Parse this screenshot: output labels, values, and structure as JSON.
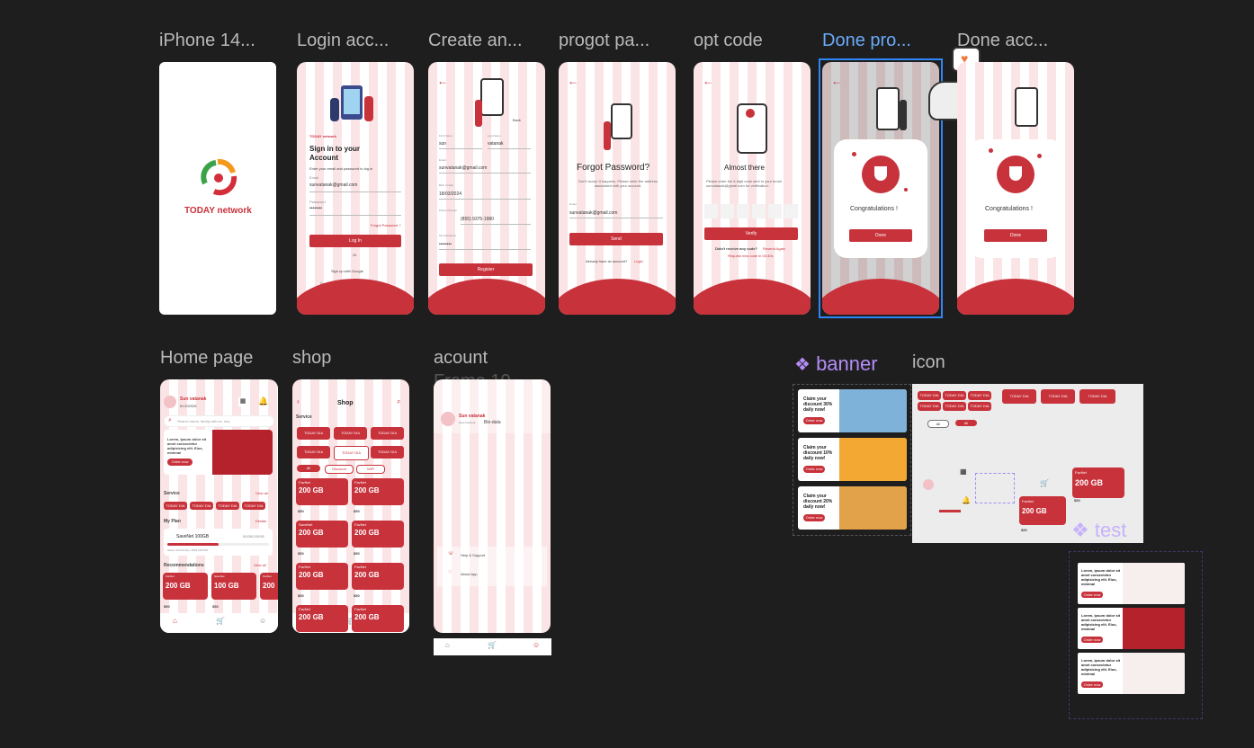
{
  "frames_row1": [
    {
      "label": "iPhone 14..."
    },
    {
      "label": "Login acc..."
    },
    {
      "label": "Create an..."
    },
    {
      "label": "progot pa..."
    },
    {
      "label": "opt code"
    },
    {
      "label": "Done pro..."
    },
    {
      "label": "Done acc..."
    }
  ],
  "frames_row2": [
    {
      "label": "Home page"
    },
    {
      "label": "shop"
    },
    {
      "label": "acount"
    },
    {
      "label": "Frame 10..."
    }
  ],
  "components": {
    "banner": "banner",
    "icon": "icon",
    "test": "test"
  },
  "splash": {
    "brand": "TODAY network"
  },
  "login": {
    "brand": "TODAY network",
    "title_line1": "Sign in to your",
    "title_line2": "Account",
    "subtitle": "Enter your email and password to log in",
    "email_label": "Email",
    "email_value": "sunvatanak@gmail.com",
    "password_label": "Password",
    "password_value": "••••••••",
    "forgot": "Forgot Password ?",
    "login_btn": "Log In",
    "or": "Or",
    "google": "Sign up with Google",
    "no_account": "Don't have an account?",
    "signup": "Sign Up"
  },
  "create": {
    "back": "Back",
    "first_name_label": "First Name",
    "first_name": "sun",
    "last_name_label": "Last Name",
    "last_name": "vatanak",
    "email_label": "Email",
    "email": "sunvatanak@gmail.com",
    "dob_label": "Birth of date",
    "dob": "18/03/2024",
    "phone_label": "Phone Number",
    "phone": "(855) 9375-1980",
    "password_label": "Set Password",
    "password": "••••••••",
    "register": "Register",
    "have_account": "Already have an account?",
    "login": "Login"
  },
  "forgot": {
    "title": "Forgot Password?",
    "desc": "Don't worry! It happens. Please enter the address associated with your account.",
    "email_label": "Email",
    "email": "sunvatanak@gmail.com",
    "send": "Send",
    "have_account": "Already have an account?",
    "login": "Login"
  },
  "otp": {
    "title": "Almost there",
    "desc": "Please enter the 6-digit code sent to your email sunvatanak@gmail.com for verification.",
    "verify": "Verify",
    "didnt_receive": "Didn't receive any code?",
    "resend": "Resend Again",
    "request": "Request new code in 00:30s"
  },
  "done": {
    "title": "Congratulations !",
    "button": "Done"
  },
  "home": {
    "name": "Sun vatanak",
    "id": "ID:202026",
    "search": "Search name, family with ex. key",
    "banner_text": "Lorem, ipsum dolor sit amet consectetur adipisicing elit. Eius, minima!",
    "order_now": "Order now",
    "service": "Service",
    "view_all": "View all",
    "chip": "TODAY DIA",
    "my_plan": "My Plan",
    "details": "Details",
    "plan_name": "SaveNet 100GB",
    "plan_amount": "50GB/100GB",
    "plan_active": "Active until 31 Dec, 2024 9:00 AM",
    "recommendations": "Recommendations",
    "view_all2": "View all",
    "cards": [
      {
        "tag": "FavNet",
        "gb": "200 GB",
        "price": "$50",
        "old": "$30"
      },
      {
        "tag": "SaveNet",
        "gb": "100 GB",
        "price": "$50",
        "old": "$30"
      },
      {
        "tag": "FavNet",
        "gb": "200",
        "price": "$50",
        "old": ""
      }
    ]
  },
  "shop": {
    "title": "Shop",
    "service": "Service",
    "chip": "TODAY DIA",
    "tabs": [
      "All",
      "Discount",
      "WiFi"
    ],
    "card_tag": "FavNet",
    "card_gb": "200 GB",
    "card_days": "30 days active",
    "card_price": "$50",
    "card_old": "$30",
    "card_tag2": "SaveNet"
  },
  "account": {
    "name": "Sun vatanak",
    "bio": "Bio-data",
    "handle": "@sunvatanak",
    "help": "Help & Support",
    "about": "About App"
  },
  "banners": [
    {
      "text": "Claim your discount 30% daily now!",
      "btn": "Order now"
    },
    {
      "text": "Claim your discount 10% daily now!",
      "btn": "Order now"
    },
    {
      "text": "Claim your discount 20% daily now!",
      "btn": "Order now"
    }
  ],
  "icon_panel": {
    "chip": "TODAY DIA",
    "all": "All",
    "gb": "200 GB",
    "tag": "FavNet",
    "price": "$50",
    "old": "$30"
  },
  "test_banners": [
    {
      "text": "Lorem, ipsum dolor sit amet consectetur adipisicing elit. Eius, minima!",
      "btn": "Order now"
    },
    {
      "text": "Lorem, ipsum dolor sit amet consectetur adipisicing elit. Eius, minima!",
      "btn": "Order now"
    },
    {
      "text": "Lorem, ipsum dolor sit amet consectetur adipisicing elit. Eius, minima!",
      "btn": "Order now"
    }
  ],
  "colors": {
    "brand_red": "#c8323b",
    "selection_blue": "#2f86f6",
    "component_purple": "#b48cf7",
    "canvas": "#1e1e1e"
  },
  "icons": [
    "back-arrow-icon",
    "shield-check-icon",
    "bell-icon",
    "home-icon",
    "cart-icon",
    "user-icon",
    "search-icon",
    "component-diamond-icon",
    "heart-icon",
    "cat-sticker-icon"
  ]
}
